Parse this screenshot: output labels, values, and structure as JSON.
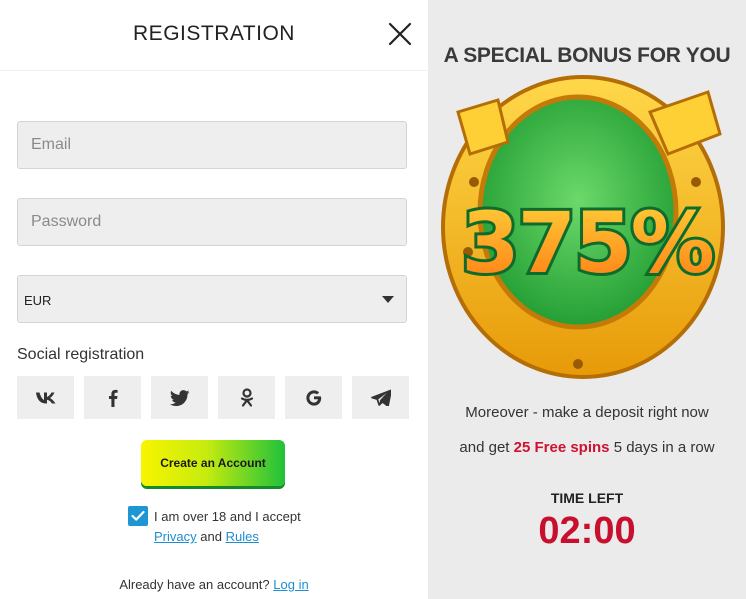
{
  "registration": {
    "title": "REGISTRATION",
    "email_placeholder": "Email",
    "password_placeholder": "Password",
    "currency_selected": "EUR",
    "social_label": "Social registration",
    "social_icons": [
      "vk-icon",
      "facebook-icon",
      "twitter-icon",
      "odnoklassniki-icon",
      "google-icon",
      "telegram-icon"
    ],
    "create_button": "Create an Account",
    "agree_checked": true,
    "agree_text": "I am over 18 and I accept",
    "privacy_link": "Privacy",
    "and_text": "and",
    "rules_link": "Rules",
    "already_text": "Already have an account?",
    "login_link": "Log in"
  },
  "bonus": {
    "title": "A SPECIAL BONUS FOR YOU",
    "percent": "375%",
    "line1": "Moreover - make a deposit right now",
    "line2_pre": "and get",
    "free_spins": "25 Free spins",
    "line2_post": "5 days in a row",
    "time_label": "TIME LEFT",
    "timer": "02:00"
  },
  "colors": {
    "accent_blue": "#1e96d4",
    "timer_red": "#c8102e",
    "panel_gray": "#ebebeb",
    "button_green": "#20c13b",
    "button_yellow": "#f8f400"
  }
}
